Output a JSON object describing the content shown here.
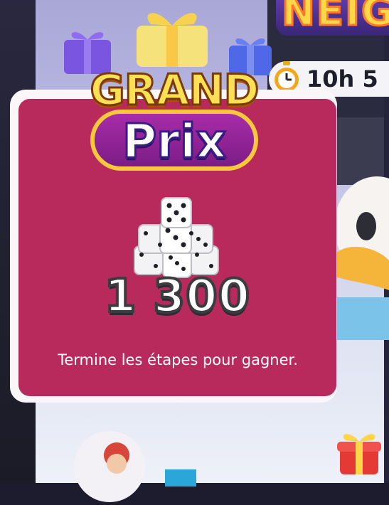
{
  "event": {
    "title_partial": "NEIG",
    "timer": "10h 5"
  },
  "reward_card": {
    "logo_line1": "GRAND",
    "logo_line2": "Prix",
    "reward_icon": "dice-stack-icon",
    "amount": "1 300",
    "description": "Termine les étapes pour gagner."
  },
  "buttons": {
    "gift_icon": "gift-box-icon",
    "avatar_icon": "player-avatar-icon"
  },
  "colors": {
    "card_background": "#b72a5b",
    "card_border": "#fbf7f8",
    "logo_gold": "#ffdf53",
    "logo_purple": "#7c1c86"
  }
}
